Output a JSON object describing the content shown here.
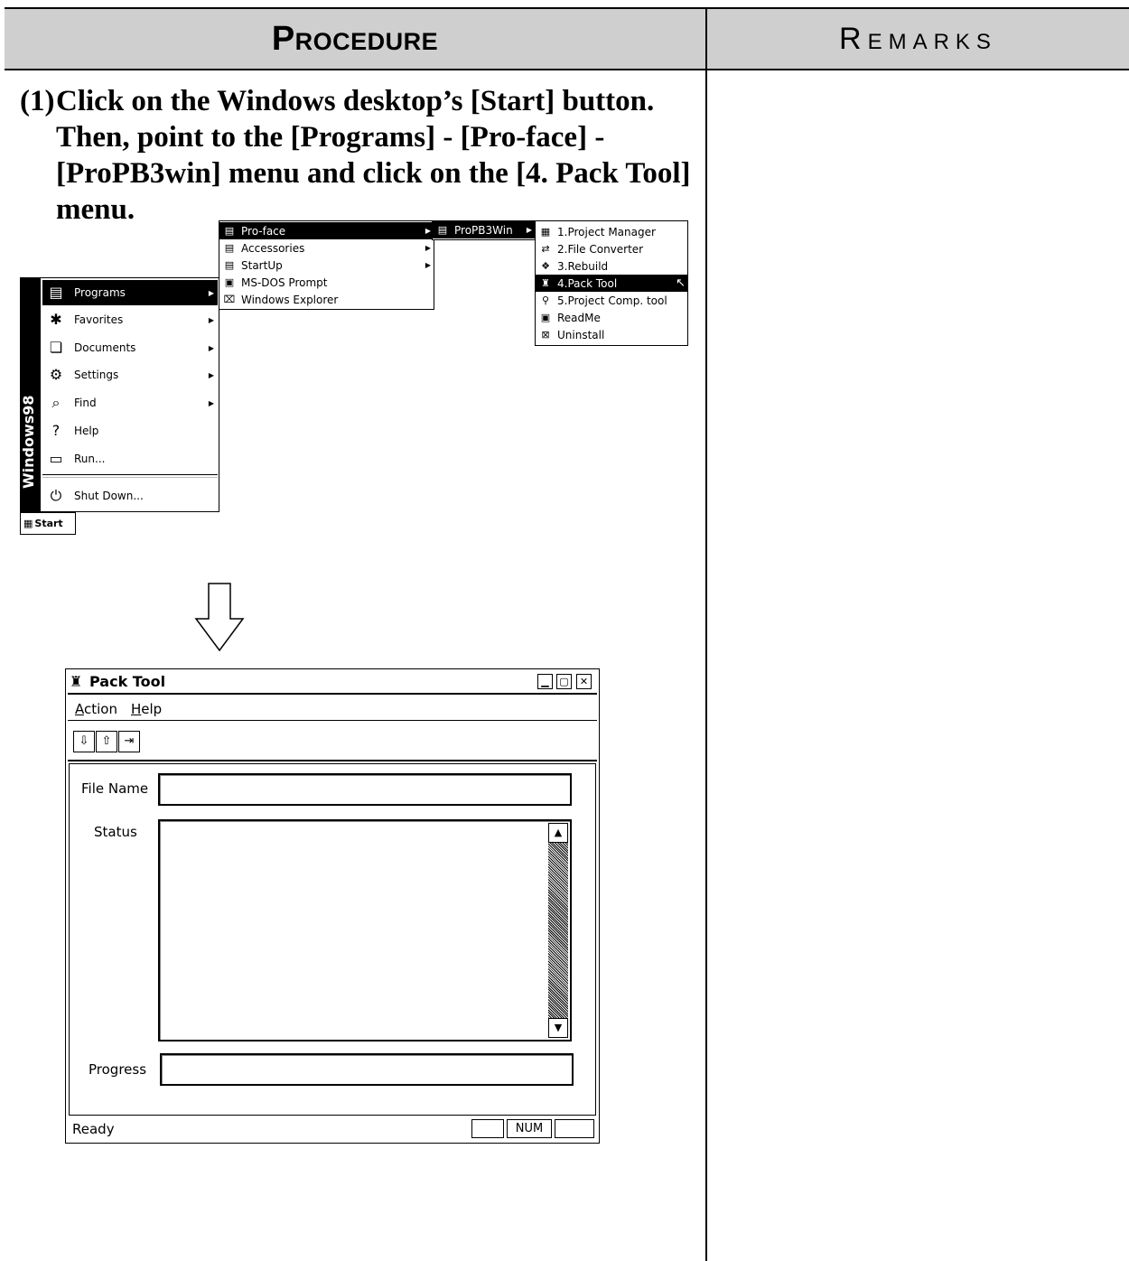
{
  "header": {
    "procedure": "Procedure",
    "remarks": "Remarks"
  },
  "step": {
    "number": "(1)",
    "text": "Click on the Windows desktop’s [Start] button. Then, point to the [Programs] - [Pro-face] - [ProPB3win] menu and click on the [4. Pack Tool] menu."
  },
  "start_menu": {
    "brand": "Windows98",
    "items": [
      {
        "label": "Programs",
        "icon": "programs-folder-icon",
        "submenu": true,
        "selected": true
      },
      {
        "label": "Favorites",
        "icon": "favorites-icon",
        "submenu": true
      },
      {
        "label": "Documents",
        "icon": "documents-icon",
        "submenu": true
      },
      {
        "label": "Settings",
        "icon": "settings-icon",
        "submenu": true
      },
      {
        "label": "Find",
        "icon": "find-icon",
        "submenu": true
      },
      {
        "label": "Help",
        "icon": "help-icon",
        "submenu": false
      },
      {
        "label": "Run...",
        "icon": "run-icon",
        "submenu": false
      },
      {
        "label": "Shut Down...",
        "icon": "shutdown-icon",
        "submenu": false
      }
    ],
    "start_button": "Start"
  },
  "programs_menu": {
    "items": [
      {
        "label": "Pro-face",
        "submenu": true,
        "selected": true
      },
      {
        "label": "Accessories",
        "submenu": true
      },
      {
        "label": "StartUp",
        "submenu": true
      },
      {
        "label": "MS-DOS Prompt",
        "submenu": false
      },
      {
        "label": "Windows Explorer",
        "submenu": false
      }
    ]
  },
  "proface_menu": {
    "items": [
      {
        "label": "ProPB3Win",
        "submenu": true,
        "selected": true
      }
    ]
  },
  "propb3win_menu": {
    "items": [
      {
        "label": "1.Project Manager"
      },
      {
        "label": "2.File Converter"
      },
      {
        "label": "3.Rebuild"
      },
      {
        "label": "4.Pack Tool",
        "selected": true
      },
      {
        "label": "5.Project Comp. tool"
      },
      {
        "label": "ReadMe"
      },
      {
        "label": "Uninstall"
      }
    ]
  },
  "pack_tool": {
    "title": "Pack Tool",
    "menus": [
      "Action",
      "Help"
    ],
    "menu_mnemonics": [
      "A",
      "H"
    ],
    "toolbar": [
      "pack-icon",
      "unpack-icon",
      "exit-icon"
    ],
    "file_name_label": "File Name",
    "status_label": "Status",
    "progress_label": "Progress",
    "status_bar_text": "Ready",
    "status_indicators": [
      "",
      "NUM",
      ""
    ]
  }
}
